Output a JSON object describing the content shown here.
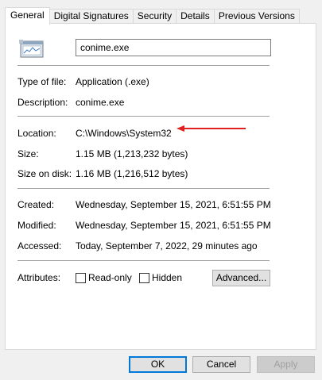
{
  "tabs": [
    "General",
    "Digital Signatures",
    "Security",
    "Details",
    "Previous Versions"
  ],
  "file_name": "conime.exe",
  "app_icon": "application-window-icon",
  "rows": {
    "type": {
      "label": "Type of file:",
      "value": "Application (.exe)"
    },
    "description": {
      "label": "Description:",
      "value": "conime.exe"
    },
    "location": {
      "label": "Location:",
      "value": "C:\\Windows\\System32"
    },
    "size": {
      "label": "Size:",
      "value": "1.15 MB (1,213,232 bytes)"
    },
    "size_on_disk": {
      "label": "Size on disk:",
      "value": "1.16 MB (1,216,512 bytes)"
    },
    "created": {
      "label": "Created:",
      "value": "Wednesday, September 15, 2021, 6:51:55 PM"
    },
    "modified": {
      "label": "Modified:",
      "value": "Wednesday, September 15, 2021, 6:51:55 PM"
    },
    "accessed": {
      "label": "Accessed:",
      "value": "Today, September 7, 2022, 29 minutes ago"
    }
  },
  "attributes": {
    "label": "Attributes:",
    "read_only": {
      "label": "Read-only",
      "checked": false
    },
    "hidden": {
      "label": "Hidden",
      "checked": false
    },
    "advanced_label": "Advanced..."
  },
  "annotation_color": "#e02020",
  "buttons": {
    "ok": "OK",
    "cancel": "Cancel",
    "apply": "Apply"
  }
}
